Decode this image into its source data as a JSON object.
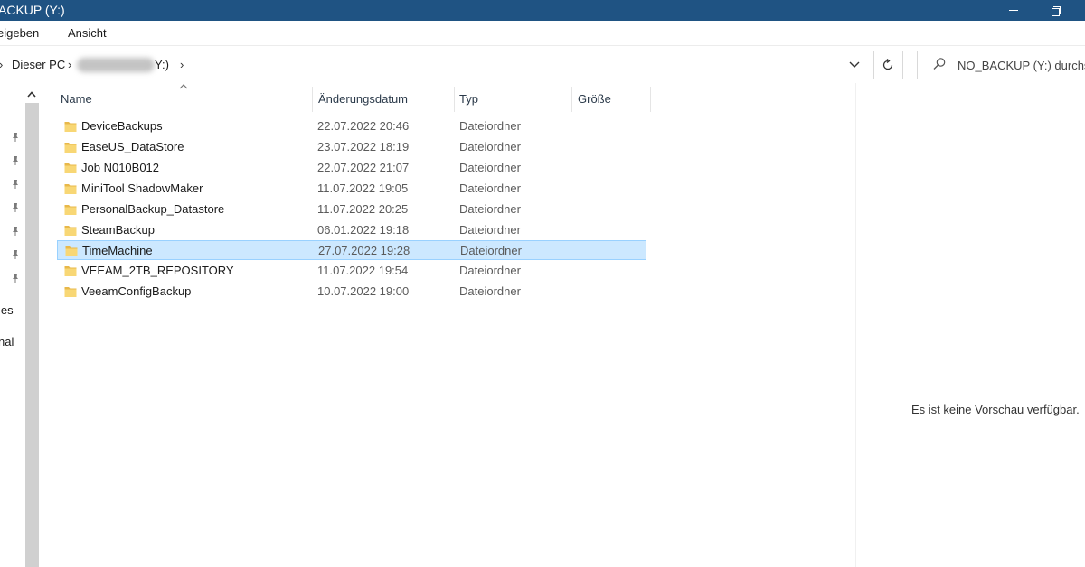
{
  "window": {
    "title": "ACKUP (Y:)"
  },
  "ribbon": {
    "tabs": [
      "eigeben",
      "Ansicht"
    ]
  },
  "address": {
    "crumbs": [
      "Dieser PC",
      "Y:)"
    ]
  },
  "search": {
    "placeholder": "NO_BACKUP (Y:) durchsu"
  },
  "nav": {
    "items": [
      "les",
      "nal"
    ]
  },
  "columns": {
    "name": "Name",
    "date": "Änderungsdatum",
    "type": "Typ",
    "size": "Größe"
  },
  "files": [
    {
      "name": "DeviceBackups",
      "date": "22.07.2022 20:46",
      "type": "Dateiordner",
      "size": ""
    },
    {
      "name": "EaseUS_DataStore",
      "date": "23.07.2022 18:19",
      "type": "Dateiordner",
      "size": ""
    },
    {
      "name": "Job N010B012",
      "date": "22.07.2022 21:07",
      "type": "Dateiordner",
      "size": ""
    },
    {
      "name": "MiniTool ShadowMaker",
      "date": "11.07.2022 19:05",
      "type": "Dateiordner",
      "size": ""
    },
    {
      "name": "PersonalBackup_Datastore",
      "date": "11.07.2022 20:25",
      "type": "Dateiordner",
      "size": ""
    },
    {
      "name": "SteamBackup",
      "date": "06.01.2022 19:18",
      "type": "Dateiordner",
      "size": ""
    },
    {
      "name": "TimeMachine",
      "date": "27.07.2022 19:28",
      "type": "Dateiordner",
      "size": ""
    },
    {
      "name": "VEEAM_2TB_REPOSITORY",
      "date": "11.07.2022 19:54",
      "type": "Dateiordner",
      "size": ""
    },
    {
      "name": "VeeamConfigBackup",
      "date": "10.07.2022 19:00",
      "type": "Dateiordner",
      "size": ""
    }
  ],
  "selected_file": "TimeMachine",
  "preview": {
    "message": "Es ist keine Vorschau verfügbar."
  },
  "colors": {
    "titlebar": "#1f5383",
    "selection": "#cce8ff",
    "selection_border": "#99d1ff",
    "folder": "#f8d775"
  }
}
